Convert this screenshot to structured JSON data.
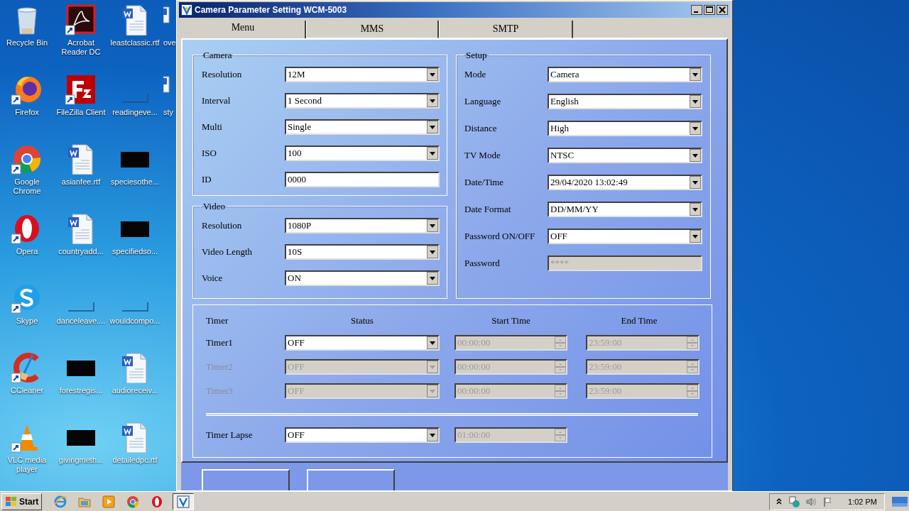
{
  "desktop": {
    "icons": [
      {
        "label": "Recycle Bin",
        "kind": "recycle",
        "shortcut": false
      },
      {
        "label": "Firefox",
        "kind": "firefox",
        "shortcut": true
      },
      {
        "label": "Google Chrome",
        "kind": "chrome",
        "shortcut": true
      },
      {
        "label": "Opera",
        "kind": "opera",
        "shortcut": true
      },
      {
        "label": "Skype",
        "kind": "skype",
        "shortcut": true
      },
      {
        "label": "CCleaner",
        "kind": "ccleaner",
        "shortcut": true
      },
      {
        "label": "VLC media player",
        "kind": "vlc",
        "shortcut": true
      },
      {
        "label": "Acrobat Reader DC",
        "kind": "acrobat",
        "shortcut": true
      },
      {
        "label": "FileZilla Client",
        "kind": "filezilla",
        "shortcut": true
      },
      {
        "label": "asianfee.rtf",
        "kind": "word",
        "shortcut": false
      },
      {
        "label": "countryadd...",
        "kind": "word",
        "shortcut": false
      },
      {
        "label": "danceleave....",
        "kind": "blank",
        "shortcut": false
      },
      {
        "label": "forestregis...",
        "kind": "black",
        "shortcut": false
      },
      {
        "label": "givingmeth...",
        "kind": "black",
        "shortcut": false
      },
      {
        "label": "leastclassic.rtf",
        "kind": "word",
        "shortcut": false
      },
      {
        "label": "readingeve...",
        "kind": "blank",
        "shortcut": false
      },
      {
        "label": "speciesothe...",
        "kind": "black",
        "shortcut": false
      },
      {
        "label": "specifiedso...",
        "kind": "black",
        "shortcut": false
      },
      {
        "label": "wouldcompo...",
        "kind": "blank",
        "shortcut": false
      },
      {
        "label": "audioreceiv...",
        "kind": "word",
        "shortcut": false
      },
      {
        "label": "detailedpc.rtf",
        "kind": "word",
        "shortcut": false
      },
      {
        "label": "ove",
        "kind": "wordcut",
        "shortcut": false
      },
      {
        "label": "sty",
        "kind": "wordcut",
        "shortcut": false
      }
    ]
  },
  "window": {
    "title": "Camera Parameter Setting WCM-5003",
    "controls": [
      {
        "kind": "minimize"
      },
      {
        "kind": "maximize"
      },
      {
        "kind": "close"
      }
    ]
  },
  "tabs": [
    {
      "label": "Menu",
      "selected": true
    },
    {
      "label": "MMS",
      "selected": false
    },
    {
      "label": "SMTP",
      "selected": false
    }
  ],
  "camera": {
    "title": "Camera",
    "fields": [
      {
        "label": "Resolution",
        "value": "12M",
        "kind": "dropdown",
        "disabled": false
      },
      {
        "label": "Interval",
        "value": "1  Second",
        "kind": "dropdown",
        "disabled": false
      },
      {
        "label": "Multi",
        "value": "Single",
        "kind": "dropdown",
        "disabled": false
      },
      {
        "label": "ISO",
        "value": "100",
        "kind": "dropdown",
        "disabled": false
      },
      {
        "label": "ID",
        "value": "0000",
        "kind": "text",
        "disabled": false
      }
    ]
  },
  "video": {
    "title": "Video",
    "fields": [
      {
        "label": "Resolution",
        "value": "1080P",
        "kind": "dropdown",
        "disabled": false
      },
      {
        "label": "Video Length",
        "value": "10S",
        "kind": "dropdown",
        "disabled": false
      },
      {
        "label": "Voice",
        "value": "ON",
        "kind": "dropdown",
        "disabled": false
      }
    ]
  },
  "setup": {
    "title": "Setup",
    "fields": [
      {
        "label": "Mode",
        "value": "Camera",
        "kind": "dropdown",
        "disabled": false
      },
      {
        "label": "Language",
        "value": "English",
        "kind": "dropdown",
        "disabled": false
      },
      {
        "label": "Distance",
        "value": "High",
        "kind": "dropdown",
        "disabled": false
      },
      {
        "label": "TV Mode",
        "value": "NTSC",
        "kind": "dropdown",
        "disabled": false
      },
      {
        "label": "Date/Time",
        "value": "29/04/2020 13:02:49",
        "kind": "dropdown",
        "disabled": false
      },
      {
        "label": "Date Format",
        "value": "DD/MM/YY",
        "kind": "dropdown",
        "disabled": false
      },
      {
        "label": "Password ON/OFF",
        "value": "OFF",
        "kind": "dropdown",
        "disabled": false
      },
      {
        "label": "Password",
        "value": "****",
        "kind": "text",
        "disabled": true
      }
    ]
  },
  "timers": {
    "headers": [
      "Timer",
      "Status",
      "Start Time",
      "End Time"
    ],
    "rows": [
      {
        "label": "Timer1",
        "status": "OFF",
        "start": "00:00:00",
        "end": "23:59:00",
        "disabled": false
      },
      {
        "label": "Timer2",
        "status": "OFF",
        "start": "00:00:00",
        "end": "23:59:00",
        "disabled": true
      },
      {
        "label": "Timer3",
        "status": "OFF",
        "start": "00:00:00",
        "end": "23:59:00",
        "disabled": true
      }
    ],
    "lapse": {
      "label": "Timer Lapse",
      "status": "OFF",
      "time": "01:00:00"
    }
  },
  "footer_buttons": [
    {
      "kind": "push"
    },
    {
      "kind": "push"
    }
  ],
  "taskbar": {
    "start": "Start",
    "items": [
      {
        "kind": "ie",
        "selected": false
      },
      {
        "kind": "folder",
        "selected": false
      },
      {
        "kind": "media",
        "selected": false
      },
      {
        "kind": "chrome",
        "selected": false
      },
      {
        "kind": "opera",
        "selected": false
      },
      {
        "kind": "app",
        "selected": true
      }
    ],
    "tray": [
      {
        "kind": "chevron"
      },
      {
        "kind": "network"
      },
      {
        "kind": "speaker"
      },
      {
        "kind": "flag"
      }
    ],
    "clock": "1:02 PM"
  }
}
